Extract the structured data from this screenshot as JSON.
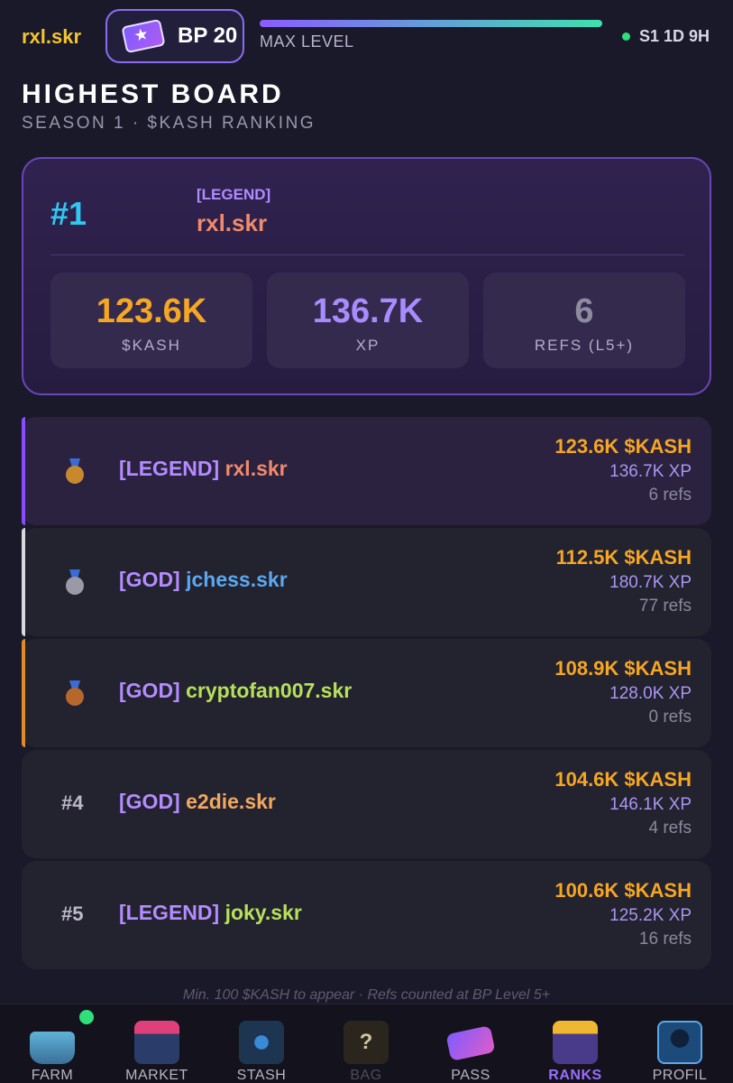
{
  "header": {
    "username": "rxl.skr",
    "bp_label": "BP 20",
    "level_label": "MAX LEVEL",
    "season_status": "S1 1D 9H"
  },
  "page": {
    "title": "HIGHEST BOARD",
    "subtitle": "SEASON 1 · $KASH RANKING"
  },
  "hero": {
    "rank": "#1",
    "tier": "[LEGEND]",
    "name": "rxl.skr",
    "stats": [
      {
        "value": "123.6K",
        "label": "$KASH",
        "color": "#f5a623"
      },
      {
        "value": "136.7K",
        "label": "XP",
        "color": "#a88cff"
      },
      {
        "value": "6",
        "label": "REFS (L5+)",
        "color": "#8f8b9e"
      }
    ]
  },
  "leaderboard": [
    {
      "rank": "",
      "medal": "gold",
      "tier": "[LEGEND]",
      "name": "rxl.skr",
      "name_color": "#f08a6a",
      "kash": "123.6K $KASH",
      "xp": "136.7K XP",
      "refs": "6 refs",
      "accent": "#8a4cff"
    },
    {
      "rank": "",
      "medal": "silver",
      "tier": "[GOD]",
      "name": "jchess.skr",
      "name_color": "#5aa8f0",
      "kash": "112.5K $KASH",
      "xp": "180.7K XP",
      "refs": "77 refs",
      "accent": "#d8d8df"
    },
    {
      "rank": "",
      "medal": "bronze",
      "tier": "[GOD]",
      "name": "cryptofan007.skr",
      "name_color": "#b6e05a",
      "kash": "108.9K $KASH",
      "xp": "128.0K XP",
      "refs": "0 refs",
      "accent": "#e08a2a"
    },
    {
      "rank": "#4",
      "medal": "",
      "tier": "[GOD]",
      "name": "e2die.skr",
      "name_color": "#f0a860",
      "kash": "104.6K $KASH",
      "xp": "146.1K XP",
      "refs": "4 refs",
      "accent": ""
    },
    {
      "rank": "#5",
      "medal": "",
      "tier": "[LEGEND]",
      "name": "joky.skr",
      "name_color": "#b6e05a",
      "kash": "100.6K $KASH",
      "xp": "125.2K XP",
      "refs": "16 refs",
      "accent": ""
    }
  ],
  "footnote": "Min. 100 $KASH to appear · Refs counted at BP Level 5+",
  "nav": [
    {
      "label": "FARM",
      "icon": "planter-icon",
      "state": "normal",
      "notification": true
    },
    {
      "label": "MARKET",
      "icon": "market-stall-icon",
      "state": "normal",
      "notification": false
    },
    {
      "label": "STASH",
      "icon": "vault-icon",
      "state": "normal",
      "notification": false
    },
    {
      "label": "BAG",
      "icon": "mystery-bag-icon",
      "state": "disabled",
      "notification": false
    },
    {
      "label": "PASS",
      "icon": "ticket-icon",
      "state": "normal",
      "notification": false
    },
    {
      "label": "RANKS",
      "icon": "trophy-icon",
      "state": "active",
      "notification": false
    },
    {
      "label": "PROFIL",
      "icon": "profile-icon",
      "state": "normal",
      "notification": false
    }
  ]
}
